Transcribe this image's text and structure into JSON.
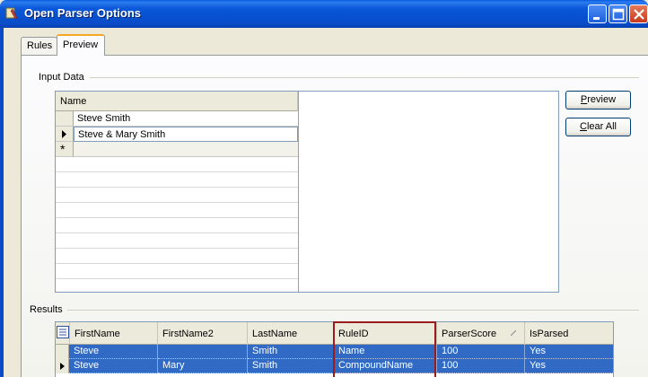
{
  "window": {
    "title": "Open Parser Options",
    "icon": "parser-app-icon",
    "controls": [
      "minimize-icon",
      "maximize-icon",
      "close-icon"
    ]
  },
  "tabs": [
    {
      "label": "Rules",
      "selected": false
    },
    {
      "label": "Preview",
      "selected": true
    }
  ],
  "input_group": {
    "title": "Input Data",
    "column_header": "Name",
    "rows": [
      {
        "value": "Steve Smith",
        "current": false
      },
      {
        "value": "Steve & Mary Smith",
        "current": true
      }
    ],
    "new_row_marker": "*"
  },
  "buttons": {
    "preview": {
      "label": "Preview",
      "mnemonic": "P"
    },
    "clear_all": {
      "label": "Clear All",
      "mnemonic": "C"
    }
  },
  "results_group": {
    "title": "Results",
    "columns": [
      "FirstName",
      "FirstName2",
      "LastName",
      "RuleID",
      "ParserScore",
      "IsParsed"
    ],
    "rows": [
      [
        "Steve",
        "",
        "Smith",
        "Name",
        "100",
        "Yes"
      ],
      [
        "Steve",
        "Mary",
        "Smith",
        "CompoundName",
        "100",
        "Yes"
      ]
    ],
    "highlighted_column": "RuleID",
    "selection_color": "#316ac5",
    "highlight_color": "#9a1c1c"
  }
}
